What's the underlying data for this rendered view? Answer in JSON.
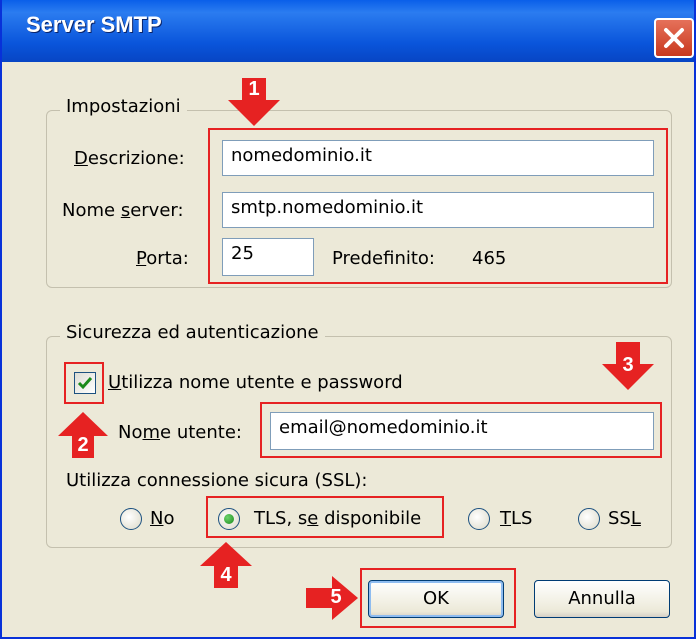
{
  "window": {
    "title": "Server SMTP",
    "colors": {
      "titlebar": "#0a55db",
      "close": "#c9391f",
      "face": "#ece9d8",
      "annotation": "#e62222",
      "check": "#1a8a1a"
    },
    "icons": {
      "close": "close-icon",
      "check": "checkmark-icon"
    }
  },
  "settings": {
    "legend": "Impostazioni",
    "description": {
      "label_pre": "",
      "label_key": "D",
      "label_post": "escrizione:",
      "value": "nomedominio.it"
    },
    "server": {
      "label_pre": "Nome ",
      "label_key": "s",
      "label_post": "erver:",
      "value": "smtp.nomedominio.it"
    },
    "port": {
      "label_pre": "",
      "label_key": "P",
      "label_post": "orta:",
      "value": "25",
      "default_label": "Predefinito:",
      "default_value": "465"
    }
  },
  "security": {
    "legend": "Sicurezza ed autenticazione",
    "use_auth": {
      "checked": true,
      "label_pre": "",
      "label_key": "U",
      "label_post": "tilizza nome utente e password"
    },
    "username": {
      "label_pre": "No",
      "label_key": "m",
      "label_post": "e utente:",
      "value": "email@nomedominio.it"
    },
    "ssl_label": "Utilizza connessione sicura (SSL):",
    "ssl_options": [
      {
        "label_pre": "",
        "label_key": "N",
        "label_post": "o",
        "selected": false
      },
      {
        "label_pre": "TLS, s",
        "label_key": "e",
        "label_post": " disponibile",
        "selected": true
      },
      {
        "label_pre": "",
        "label_key": "T",
        "label_post": "LS",
        "selected": false
      },
      {
        "label_pre": "SS",
        "label_key": "L",
        "label_post": "",
        "selected": false
      }
    ]
  },
  "buttons": {
    "ok": "OK",
    "cancel": "Annulla"
  },
  "annotations": [
    "1",
    "2",
    "3",
    "4",
    "5"
  ]
}
